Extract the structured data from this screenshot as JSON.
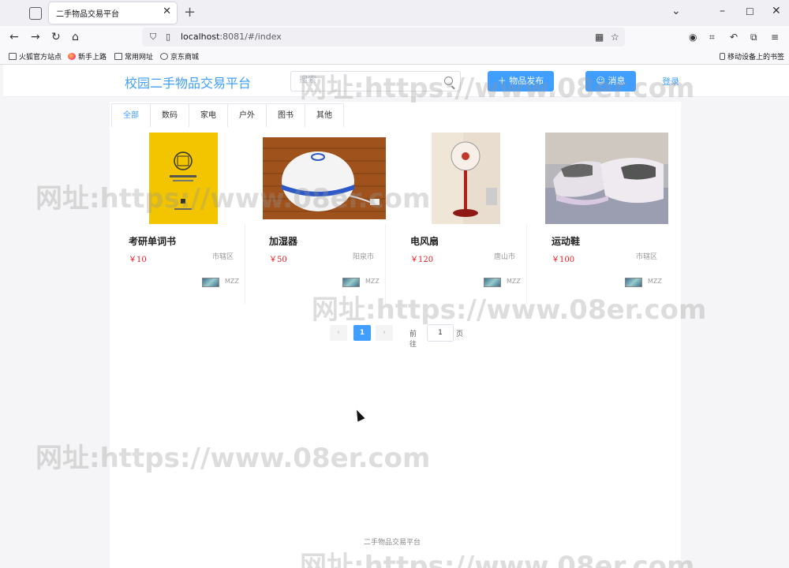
{
  "browser": {
    "tab_title": "二手物品交易平台",
    "url_host": "localhost",
    "url_rest": ":8081/#/index",
    "bookmarks": [
      "火狐官方站点",
      "新手上路",
      "常用网址",
      "京东商城"
    ],
    "mobile_bookmarks": "移动设备上的书签"
  },
  "header": {
    "site_title": "校园二手物品交易平台",
    "search_placeholder": "搜索",
    "publish_label": "＋ 物品发布",
    "message_label": "☺ 消息",
    "login_label": "登录"
  },
  "categories": [
    "全部",
    "数码",
    "家电",
    "户外",
    "图书",
    "其他"
  ],
  "products": [
    {
      "name": "考研单词书",
      "price": "￥10",
      "region": "市辖区",
      "seller": "MZZ"
    },
    {
      "name": "加湿器",
      "price": "￥50",
      "region": "阳泉市",
      "seller": "MZZ"
    },
    {
      "name": "电风扇",
      "price": "￥120",
      "region": "唐山市",
      "seller": "MZZ"
    },
    {
      "name": "运动鞋",
      "price": "￥100",
      "region": "市辖区",
      "seller": "MZZ"
    }
  ],
  "pagination": {
    "prev": "‹",
    "current_page": "1",
    "next": "›",
    "goto_label": "前往",
    "goto_value": "1",
    "unit_label": "页"
  },
  "footer": "二手物品交易平台",
  "watermark": "网址:https://www.08er.com"
}
